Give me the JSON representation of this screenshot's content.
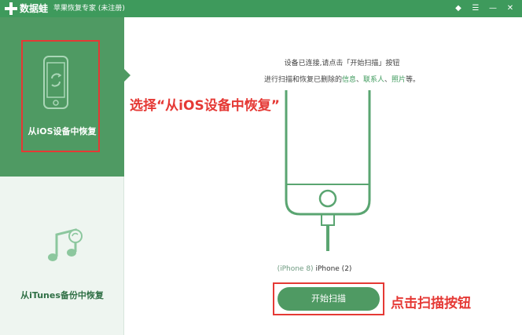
{
  "window": {
    "app_name": "数据蛙",
    "title": "苹果恢复专家 (未注册)",
    "controls": [
      "diamond-icon",
      "menu-icon",
      "minimize-icon",
      "close-icon"
    ]
  },
  "sidebar": {
    "items": [
      {
        "label": "从iOS设备中恢复",
        "icon": "phone-recover-icon",
        "active": true
      },
      {
        "label": "从iTunes备份中恢复",
        "icon": "music-note-icon",
        "active": false
      }
    ]
  },
  "main": {
    "instruction_line1": "设备已连接,请点击「开始扫描」按钮",
    "instruction_line2_prefix": "进行扫描和恢复已删除的",
    "link_info": "信息",
    "link_sep1": "、",
    "link_contacts": "联系人",
    "link_sep2": "、",
    "link_photos": "照片",
    "instruction_line2_suffix": "等。",
    "device_model": "(iPhone 8)",
    "device_name": "iPhone (2)",
    "scan_button": "开始扫描"
  },
  "annotations": {
    "select_hint": "选择“从iOS设备中恢复”",
    "click_hint": "点击扫描按钮"
  },
  "colors": {
    "brand_green": "#3e9a5c",
    "sidebar_active": "#4f9a63",
    "annotation_red": "#e53935"
  }
}
